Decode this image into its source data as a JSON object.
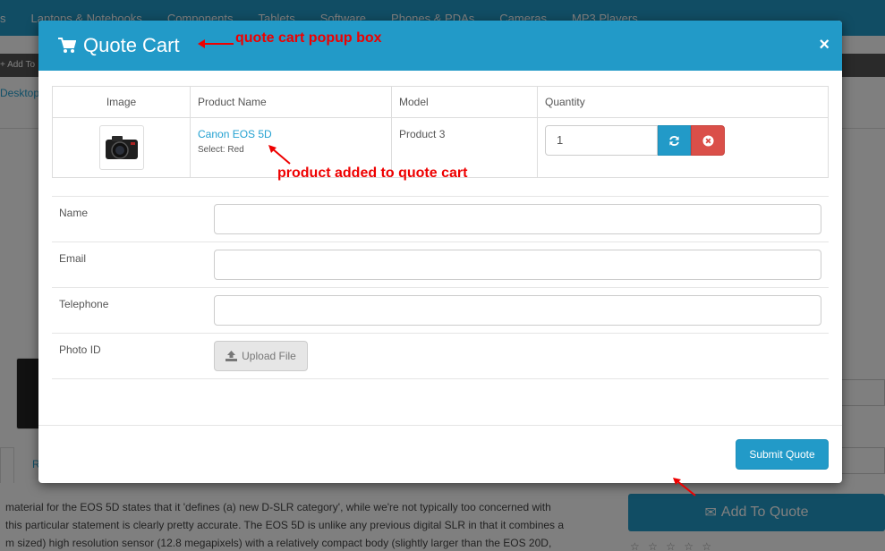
{
  "background": {
    "nav_items": [
      "s",
      "Laptops & Notebooks",
      "Components",
      "Tablets",
      "Software",
      "Phones & PDAs",
      "Cameras",
      "MP3 Players"
    ],
    "strip_text": "+ Add To",
    "breadcrumb": "Desktop",
    "tab_label": "R",
    "description_lines": [
      "material for the EOS 5D states that it 'defines (a) new D-SLR category', while we're not typically too concerned with",
      "this particular statement is clearly pretty accurate. The EOS 5D is unlike any previous digital SLR in that it combines a",
      "m sized) high resolution sensor (12.8 megapixels) with a relatively compact body (slightly larger than the EOS 20D,"
    ],
    "add_to_quote_label": "Add To Quote",
    "stars": "☆ ☆ ☆ ☆ ☆"
  },
  "modal": {
    "title": "Quote Cart",
    "close_symbol": "×",
    "table": {
      "headers": [
        "Image",
        "Product Name",
        "Model",
        "Quantity"
      ],
      "rows": [
        {
          "product_name": "Canon EOS 5D",
          "option": "Select: Red",
          "model": "Product 3",
          "quantity": "1"
        }
      ]
    },
    "form": {
      "name_label": "Name",
      "email_label": "Email",
      "telephone_label": "Telephone",
      "photo_label": "Photo ID",
      "upload_label": "Upload File"
    },
    "submit_label": "Submit Quote"
  },
  "annotations": {
    "popup_box": "quote cart popup box",
    "product_added": "product added to quote cart"
  },
  "colors": {
    "primary": "#229ac8",
    "danger": "#da4f49",
    "annotation": "#e00000"
  }
}
